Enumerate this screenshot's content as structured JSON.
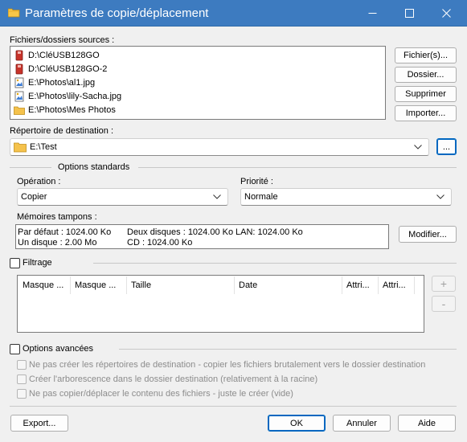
{
  "window": {
    "title": "Paramètres de copie/déplacement",
    "controls": {
      "minimize": "—",
      "maximize": "☐",
      "close": "✕"
    }
  },
  "sources": {
    "label": "Fichiers/dossiers sources :",
    "items": [
      {
        "path": "D:\\CléUSB128GO",
        "icon": "drive-icon"
      },
      {
        "path": "D:\\CléUSB128GO-2",
        "icon": "drive-icon"
      },
      {
        "path": "E:\\Photos\\al1.jpg",
        "icon": "image-file-icon"
      },
      {
        "path": "E:\\Photos\\lily-Sacha.jpg",
        "icon": "image-file-icon"
      },
      {
        "path": "E:\\Photos\\Mes Photos",
        "icon": "folder-icon"
      }
    ],
    "buttons": {
      "files": "Fichier(s)...",
      "folder": "Dossier...",
      "delete": "Supprimer",
      "import": "Importer..."
    }
  },
  "destination": {
    "label": "Répertoire de destination :",
    "value": "E:\\Test",
    "browse": "..."
  },
  "standard": {
    "section_label": "Options standards",
    "operation_label": "Opération :",
    "operation_value": "Copier",
    "priority_label": "Priorité :",
    "priority_value": "Normale",
    "buffers_label": "Mémoires tampons :",
    "buffers": {
      "default": "Par défaut : 1024.00 Ko",
      "two_disks": "Deux disques : 1024.00 Ko",
      "lan": "LAN: 1024.00 Ko",
      "one_disk": "Un disque : 2.00 Mo",
      "cd": "CD : 1024.00 Ko"
    },
    "modify_button": "Modifier..."
  },
  "filtering": {
    "label": "Filtrage",
    "checked": false,
    "columns": [
      "Masque ...",
      "Masque ...",
      "Taille",
      "Date",
      "Attri...",
      "Attri..."
    ],
    "add_button": "+",
    "remove_button": "-"
  },
  "advanced": {
    "label": "Options avancées",
    "checked": false,
    "options": [
      "Ne pas créer les répertoires de destination - copier les fichiers brutalement vers le dossier destination",
      "Créer l'arborescence dans le dossier destination (relativement à la racine)",
      "Ne pas copier/déplacer le contenu des fichiers - juste le créer (vide)"
    ]
  },
  "footer": {
    "export": "Export...",
    "ok": "OK",
    "cancel": "Annuler",
    "help": "Aide"
  },
  "colors": {
    "titlebar": "#3d7bc0",
    "accent": "#0067c0",
    "folder": "#f5c24c",
    "drive": "#c8332a"
  }
}
